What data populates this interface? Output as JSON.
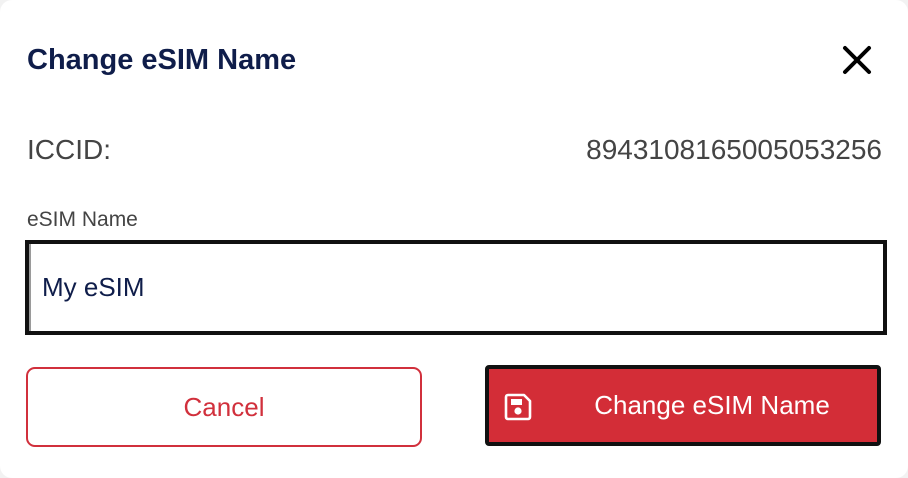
{
  "dialog": {
    "title": "Change eSIM Name",
    "close_icon": "close-icon"
  },
  "iccid": {
    "label": "ICCID:",
    "value": "8943108165005053256"
  },
  "name_field": {
    "label": "eSIM Name",
    "value": "My eSIM"
  },
  "actions": {
    "cancel_label": "Cancel",
    "submit_label": "Change eSIM Name",
    "submit_icon": "save-icon"
  },
  "colors": {
    "title": "#0f1d4a",
    "accent": "#d32d37",
    "text_muted": "#444444"
  }
}
